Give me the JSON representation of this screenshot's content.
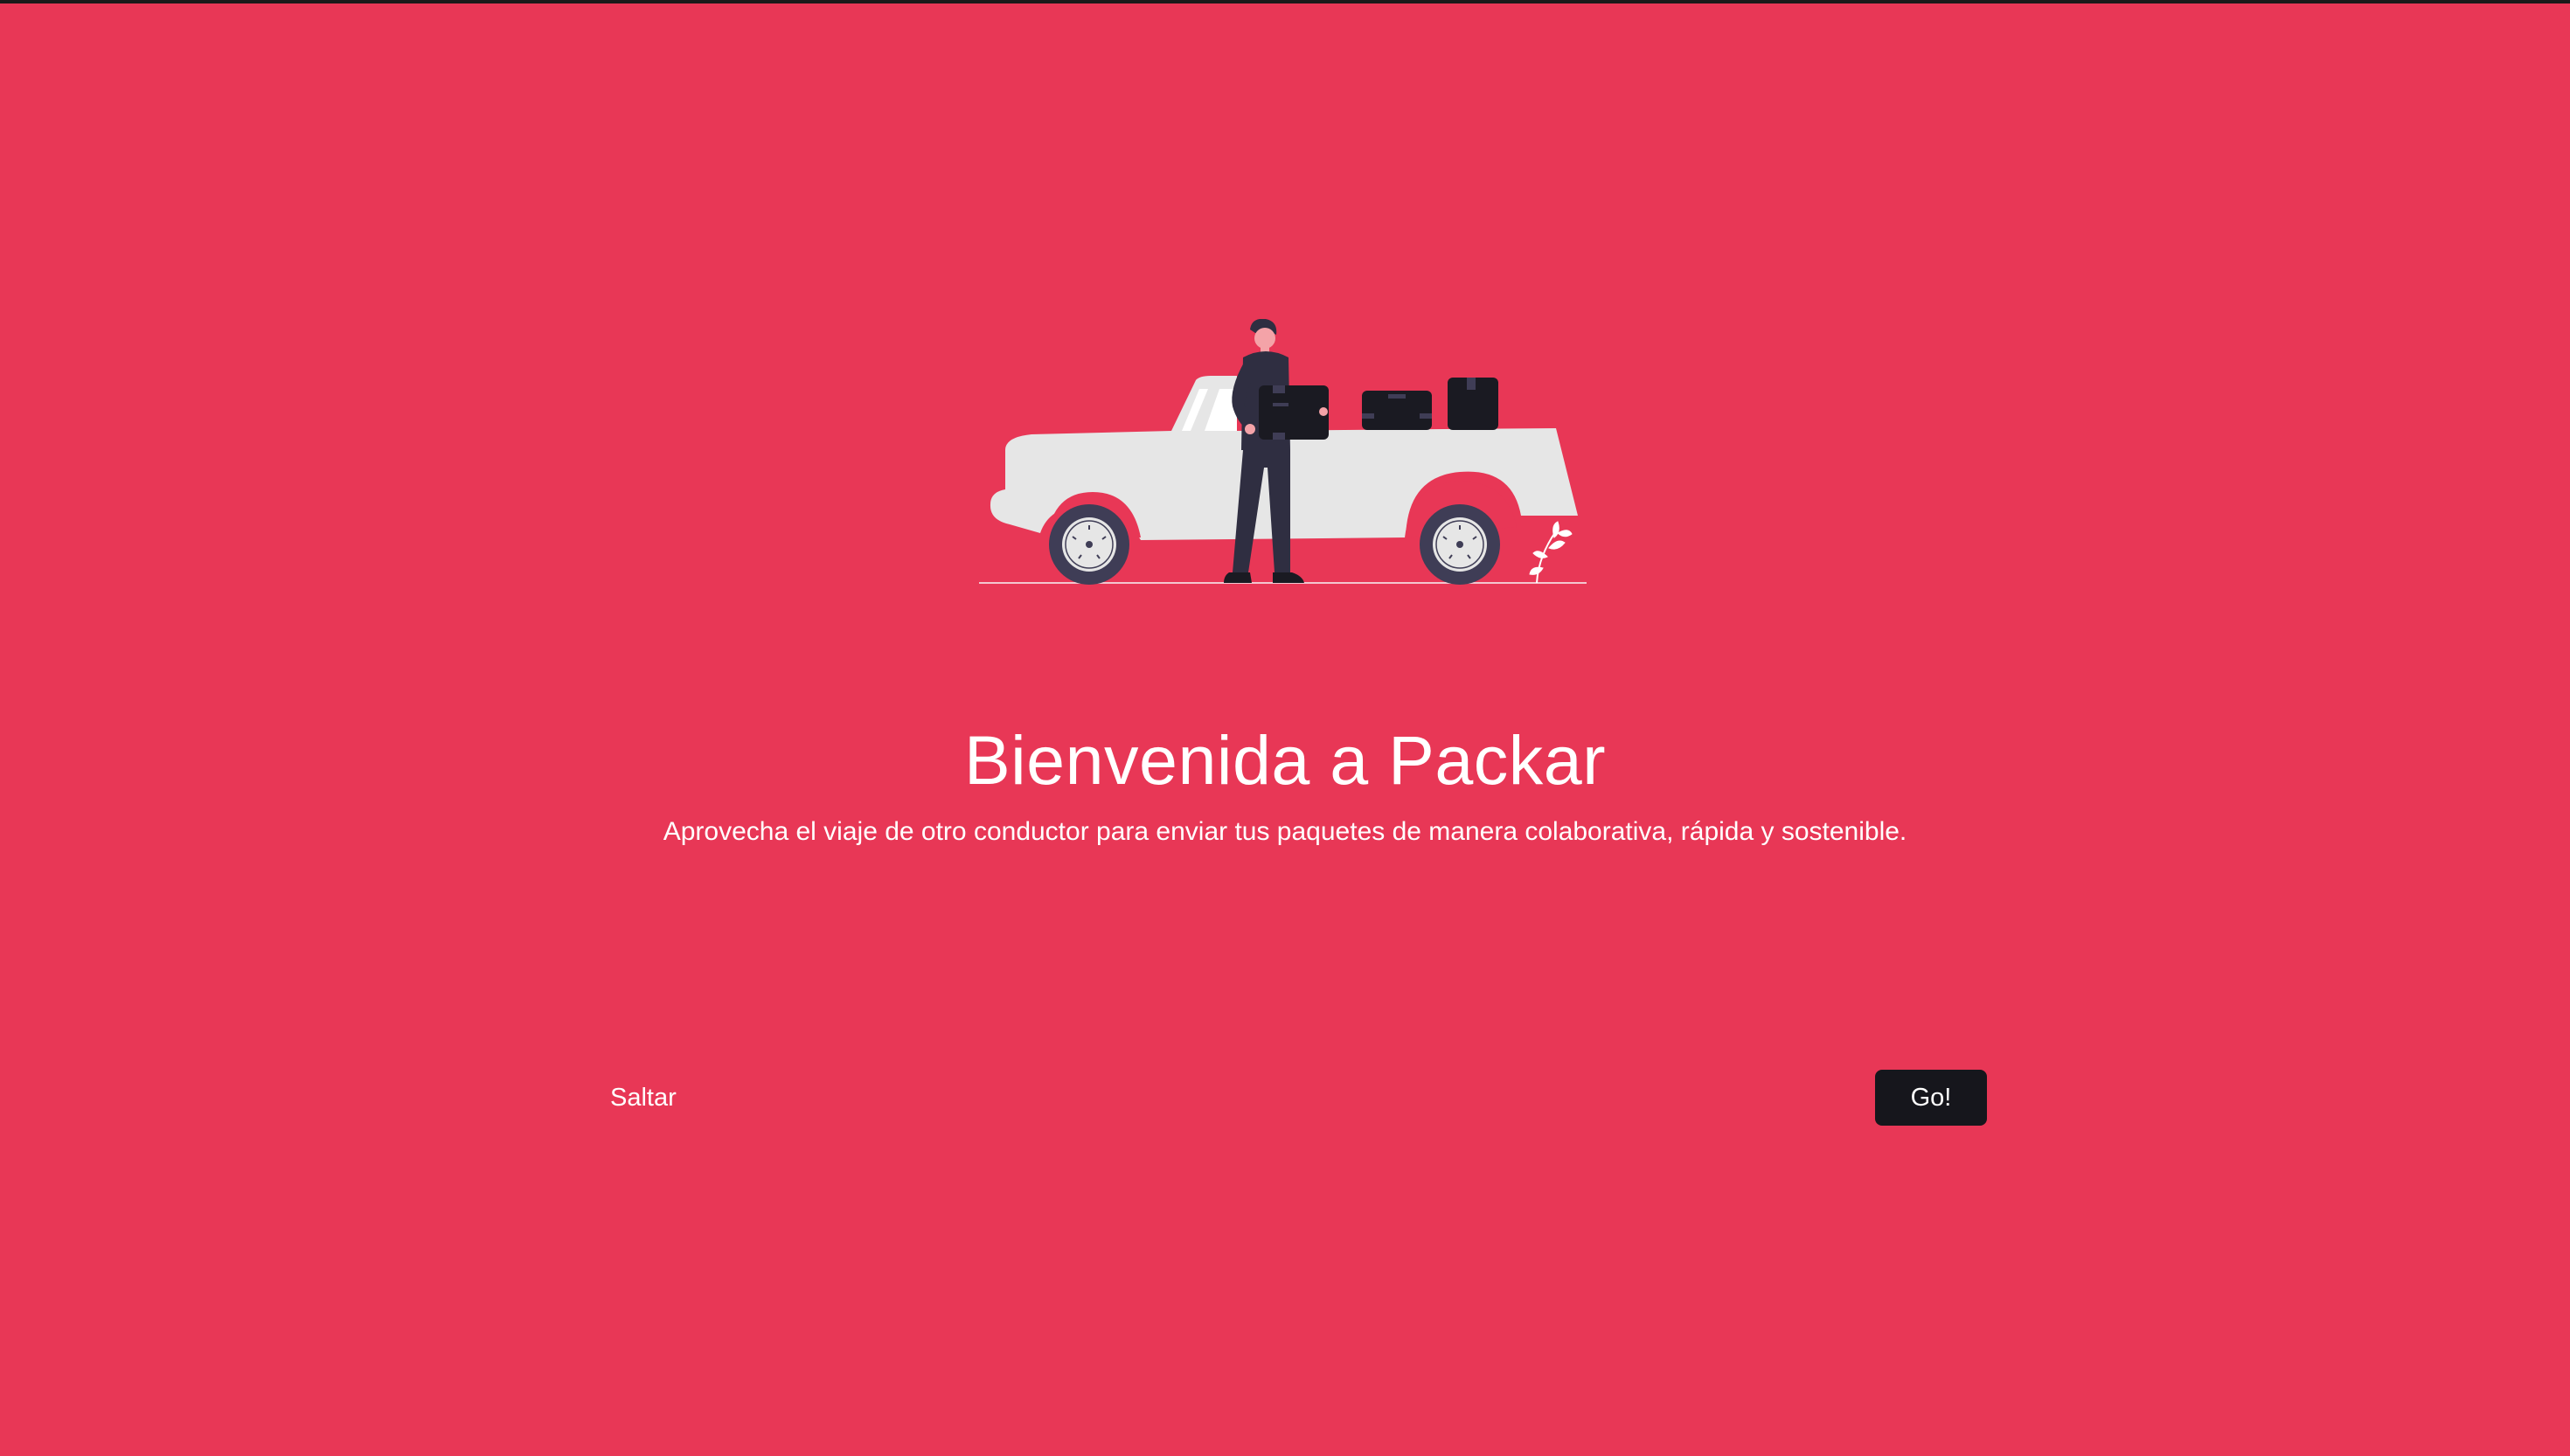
{
  "onboarding": {
    "illustration": {
      "icon": "delivery-car-illustration",
      "colors": {
        "car_body": "#E6E6E6",
        "person": "#2F2E41",
        "boxes": "#1A1A22",
        "tire": "#3F3D56"
      }
    },
    "title": "Bienvenida a Packar",
    "subtitle": "Aprovecha el viaje de otro conductor para enviar tus paquetes de manera colaborativa, rápida y sostenible.",
    "skip_label": "Saltar",
    "go_label": "Go!"
  },
  "colors": {
    "background": "#E83756",
    "text": "#FFFFFF",
    "primary_button": "#16161C"
  }
}
